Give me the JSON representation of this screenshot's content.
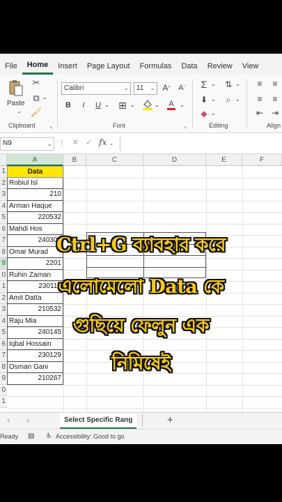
{
  "ribbon_tabs": [
    "File",
    "Home",
    "Insert",
    "Page Layout",
    "Formulas",
    "Data",
    "Review",
    "View"
  ],
  "active_tab": "Home",
  "ribbon": {
    "paste_label": "Paste",
    "clipboard_label": "Clipboard",
    "font_label": "Font",
    "editing_label": "Editing",
    "alignment_label": "Align",
    "font_name": "Calibri",
    "font_size": "11",
    "bold": "B",
    "italic": "I",
    "underline": "U",
    "grow_font": "A",
    "shrink_font": "A",
    "font_color_glyph": "A"
  },
  "formula_bar": {
    "name_box": "N9",
    "fx": "fx"
  },
  "columns": [
    "A",
    "B",
    "C",
    "D",
    "E",
    "F"
  ],
  "rows": [
    "1",
    "2",
    "3",
    "4",
    "5",
    "6",
    "7",
    "8",
    "9",
    "0",
    "1",
    "2",
    "3",
    "4",
    "5",
    "6",
    "7",
    "8",
    "9",
    "0",
    "1"
  ],
  "selected_column": "A",
  "selected_row_index": 8,
  "cells": {
    "header": "Data",
    "a2": "Robiul Isl",
    "a3": "210",
    "a4": "Arman Haque",
    "a5": "220532",
    "a6": "Mahdi Hos",
    "a7": "240301",
    "a8": "Omar Murad",
    "a9": "2201",
    "a10": "Ruhin Zaman",
    "a11": "230110",
    "a12": "Amit Datta",
    "a13": "210532",
    "a14": "Raju Mia",
    "a15": "240145",
    "a16": "Iqbal Hossain",
    "a17": "230129",
    "a18": "Osman Gani",
    "a19": "210267"
  },
  "caption": {
    "line1": "Ctrl+G ব্যাবহার করে",
    "line2": "এলোমেলো Data কে",
    "line3": "গুছিয়ে ফেলুন এক",
    "line4": "নিমিষেই"
  },
  "sheet": {
    "active_sheet": "Select Specific Rang",
    "prev_glyph": "‹",
    "next_glyph": "›",
    "add_glyph": "+"
  },
  "status": {
    "ready": "Ready",
    "accessibility": "Accessibility: Good to go"
  },
  "colors": {
    "accent": "#217346",
    "header_fill": "#ffe600",
    "caption_text": "#f6c91a"
  }
}
